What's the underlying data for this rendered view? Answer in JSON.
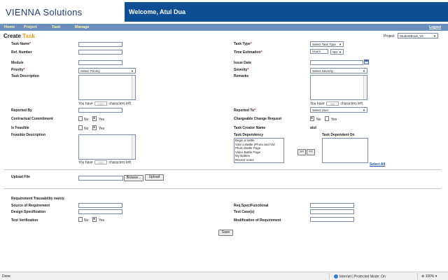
{
  "header": {
    "logo_main": "VIENNA S",
    "logo_rest": "olutions",
    "welcome": "Welcome, Atul Dua"
  },
  "nav": {
    "items": [
      "Home",
      "Project",
      "Task",
      "Manage"
    ],
    "logout": "Logout"
  },
  "page": {
    "title_prefix": "Create ",
    "title_accent": "Task",
    "project_label": "Project",
    "project_value": "StudentBook_V2",
    "accent_color": "#e1991a",
    "banner_color": "#0e4f94"
  },
  "left": {
    "task_name": "Task Name",
    "ref_number": "Ref. Number",
    "module": "Module",
    "priority": "Priority",
    "priority_value": "Select Priority",
    "task_description": "Task Description",
    "reported_by": "Reported By",
    "contractual": "Contractual Commitment",
    "is_feasible": "Is Feasible",
    "feasible_description": "Feasible Description",
    "counter_prefix": "You have",
    "counter_value": "1000",
    "counter_suffix": "characters left.",
    "no": "No",
    "yes": "Yes"
  },
  "right": {
    "task_type": "Task Type",
    "task_type_value": "Select Task Type",
    "time_estimation": "Time Estimation",
    "hours": "Hours",
    "hours_unit": "NM",
    "issue_date": "Issue Date",
    "severity": "Severity",
    "severity_value": "Select Severity",
    "remarks": "Remarks",
    "counter_value": "500",
    "reported_to": "Reported To",
    "reported_to_value": "Select User",
    "chargeable": "Chargeable Change Request",
    "task_creator": "Task Creator Name",
    "task_creator_value": "atul",
    "task_dependency": "Task Dependency",
    "task_dependent_on": "Task Dependent On",
    "dependency_options": [
      "Begin a battle",
      "Vote a Battle (Photo and Vid",
      "Photo Battle Page",
      "Video Battle Page",
      "My Battles",
      "Recent Votes"
    ],
    "move_right": ">>",
    "move_left": "<<",
    "select_all": "Select All"
  },
  "upload": {
    "label": "Upload File",
    "browse": "Browse...",
    "upload": "Upload"
  },
  "traceability": {
    "title": "Requirement Traceability matrix",
    "source": "Source of Requirement",
    "design": "Design Specification",
    "verification": "Test Verification",
    "req_spec": "Req.Spec/Functional",
    "test_cases": "Test Case(s)",
    "modification": "Modification of Requirement"
  },
  "save": "Save",
  "statusbar": {
    "left": "Done",
    "zone": "Internet | Protected Mode: On",
    "zoom": "100%"
  }
}
